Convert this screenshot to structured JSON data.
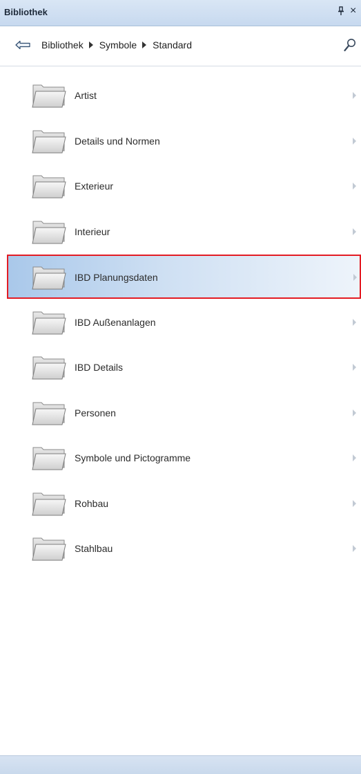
{
  "window": {
    "title": "Bibliothek"
  },
  "nav": {
    "breadcrumb": [
      "Bibliothek",
      "Symbole",
      "Standard"
    ]
  },
  "folders": [
    {
      "label": "Artist",
      "selected": false
    },
    {
      "label": "Details und Normen",
      "selected": false
    },
    {
      "label": "Exterieur",
      "selected": false
    },
    {
      "label": "Interieur",
      "selected": false
    },
    {
      "label": "IBD Planungsdaten",
      "selected": true
    },
    {
      "label": "IBD Außenanlagen",
      "selected": false
    },
    {
      "label": "IBD Details",
      "selected": false
    },
    {
      "label": "Personen",
      "selected": false
    },
    {
      "label": "Symbole und Pictogramme",
      "selected": false
    },
    {
      "label": "Rohbau",
      "selected": false
    },
    {
      "label": "Stahlbau",
      "selected": false
    }
  ],
  "colors": {
    "selection_border": "#e31b23",
    "selection_fill": "#cfe0f3",
    "titlebar": "#d9e6f5"
  }
}
